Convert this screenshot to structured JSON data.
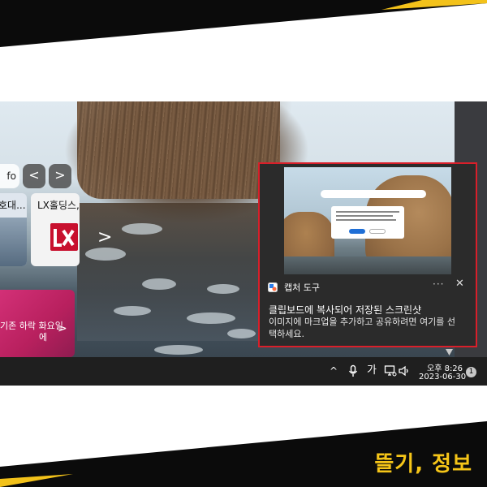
{
  "brand": {
    "text": "뜰기, 정보",
    "accent_color": "#f5c518"
  },
  "widgets": {
    "info_label": "fo",
    "nav_prev": "<",
    "nav_next": ">",
    "card_a_title": "호대...",
    "card_b_title": "LX홀딩스,...",
    "card_b_logo": "LX",
    "card_c_text_line1": "기존 하락 화요일",
    "card_c_text_line2": "에",
    "card_c_arrow": ">",
    "wallpaper_chevron": ">"
  },
  "snip_notification": {
    "app_name": "캡처 도구",
    "more_label": "···",
    "close_label": "✕",
    "title": "클립보드에 복사되어 저장된 스크린샷",
    "body_line1": "이미지에 마크업을 추가하고 공유하려면 여기를 선",
    "body_line2": "택하세요.",
    "border_color": "#d91f2a"
  },
  "taskbar": {
    "icons": [
      "chevron-up-icon",
      "microphone-icon",
      "ime-icon",
      "network-icon",
      "volume-icon"
    ],
    "ime_label": "가",
    "chevron_label": "^",
    "clock_time": "오후 8:26",
    "clock_date": "2023-06-30",
    "notification_count": "1"
  }
}
